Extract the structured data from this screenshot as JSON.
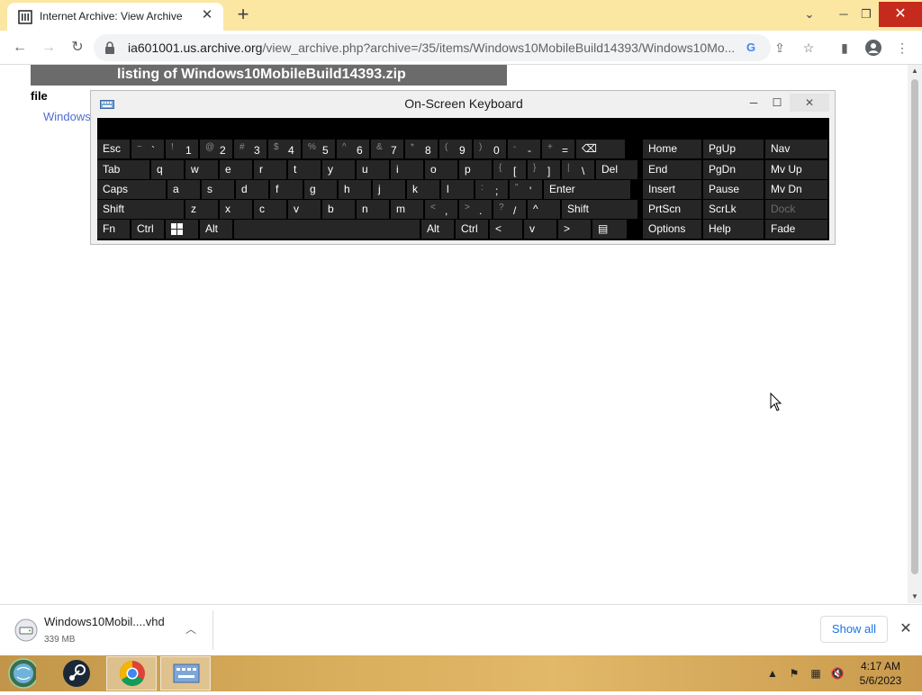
{
  "browser": {
    "tab_title": "Internet Archive: View Archive",
    "url_host": "ia601001.us.archive.org",
    "url_path": "/view_archive.php?archive=/35/items/Windows10MobileBuild14393/Windows10Mo..."
  },
  "page": {
    "listing_title": "listing of Windows10MobileBuild14393.zip",
    "column_header": "file",
    "file_link": "Windows"
  },
  "osk": {
    "title": "On-Screen Keyboard",
    "rows": [
      [
        {
          "label": "Esc"
        },
        {
          "shift": "~",
          "label": "`"
        },
        {
          "shift": "!",
          "label": "1"
        },
        {
          "shift": "@",
          "label": "2"
        },
        {
          "shift": "#",
          "label": "3"
        },
        {
          "shift": "$",
          "label": "4"
        },
        {
          "shift": "%",
          "label": "5"
        },
        {
          "shift": "^",
          "label": "6"
        },
        {
          "shift": "&",
          "label": "7"
        },
        {
          "shift": "*",
          "label": "8"
        },
        {
          "shift": "(",
          "label": "9"
        },
        {
          "shift": ")",
          "label": "0"
        },
        {
          "shift": "-",
          "label": "-"
        },
        {
          "shift": "+",
          "label": "="
        },
        {
          "label": "⌫"
        }
      ],
      [
        {
          "label": "Tab"
        },
        {
          "label": "q"
        },
        {
          "label": "w"
        },
        {
          "label": "e"
        },
        {
          "label": "r"
        },
        {
          "label": "t"
        },
        {
          "label": "y"
        },
        {
          "label": "u"
        },
        {
          "label": "i"
        },
        {
          "label": "o"
        },
        {
          "label": "p"
        },
        {
          "shift": "{",
          "label": "["
        },
        {
          "shift": "}",
          "label": "]"
        },
        {
          "shift": "|",
          "label": "\\"
        },
        {
          "label": "Del"
        }
      ],
      [
        {
          "label": "Caps"
        },
        {
          "label": "a"
        },
        {
          "label": "s"
        },
        {
          "label": "d"
        },
        {
          "label": "f"
        },
        {
          "label": "g"
        },
        {
          "label": "h"
        },
        {
          "label": "j"
        },
        {
          "label": "k"
        },
        {
          "label": "l"
        },
        {
          "shift": ":",
          "label": ";"
        },
        {
          "shift": "\"",
          "label": "'"
        },
        {
          "label": "Enter"
        }
      ],
      [
        {
          "label": "Shift"
        },
        {
          "label": "z"
        },
        {
          "label": "x"
        },
        {
          "label": "c"
        },
        {
          "label": "v"
        },
        {
          "label": "b"
        },
        {
          "label": "n"
        },
        {
          "label": "m"
        },
        {
          "shift": "<",
          "label": ","
        },
        {
          "shift": ">",
          "label": "."
        },
        {
          "shift": "?",
          "label": "/"
        },
        {
          "label": "^"
        },
        {
          "label": "Shift"
        }
      ],
      [
        {
          "label": "Fn"
        },
        {
          "label": "Ctrl"
        },
        {
          "label": "win"
        },
        {
          "label": "Alt"
        },
        {
          "label": ""
        },
        {
          "label": "Alt"
        },
        {
          "label": "Ctrl"
        },
        {
          "label": "<"
        },
        {
          "label": "v"
        },
        {
          "label": ">"
        },
        {
          "label": "menu"
        }
      ]
    ],
    "side": [
      [
        "Home",
        "PgUp",
        "Nav"
      ],
      [
        "End",
        "PgDn",
        "Mv Up"
      ],
      [
        "Insert",
        "Pause",
        "Mv Dn"
      ],
      [
        "PrtScn",
        "ScrLk",
        "Dock"
      ],
      [
        "Options",
        "Help",
        "Fade"
      ]
    ]
  },
  "downloads": {
    "file_name": "Windows10Mobil....vhd",
    "file_size": "339 MB",
    "show_all": "Show all"
  },
  "taskbar": {
    "time": "4:17 AM",
    "date": "5/6/2023"
  }
}
